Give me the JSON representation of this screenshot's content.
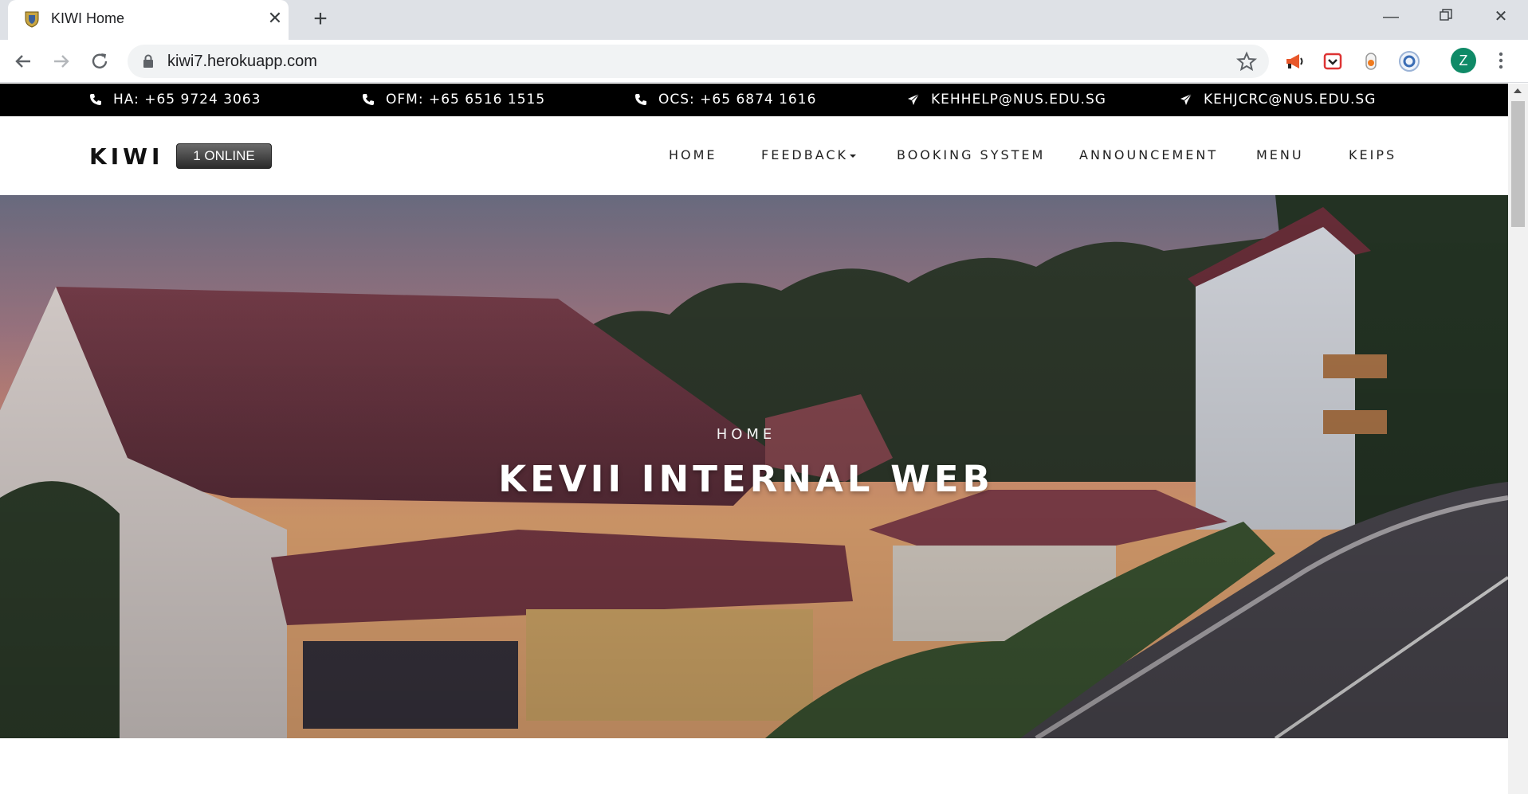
{
  "browser": {
    "tab": {
      "title": "KIWI Home"
    },
    "url": "kiwi7.herokuapp.com",
    "profile_initial": "Z",
    "extensions": [
      "megaphone-extension-icon",
      "pocket-extension-icon",
      "pill-extension-icon",
      "circle-extension-icon"
    ]
  },
  "contacts": [
    {
      "label": "HA: +65 9724 3063",
      "icon": "phone-icon"
    },
    {
      "label": "OFM: +65 6516 1515",
      "icon": "phone-icon"
    },
    {
      "label": "OCS: +65 6874 1616",
      "icon": "phone-icon"
    },
    {
      "label": "KEHHELP@NUS.EDU.SG",
      "icon": "paper-plane-icon"
    },
    {
      "label": "KEHJCRC@NUS.EDU.SG",
      "icon": "paper-plane-icon"
    }
  ],
  "navbar": {
    "brand": "KIWI",
    "online_badge": "1 ONLINE",
    "items": [
      {
        "label": "HOME"
      },
      {
        "label": "FEEDBACK"
      },
      {
        "label": "BOOKING SYSTEM"
      },
      {
        "label": "ANNOUNCEMENT"
      },
      {
        "label": "MENU"
      },
      {
        "label": "KEIPS"
      }
    ]
  },
  "hero": {
    "subtitle": "HOME",
    "title": "KEVII INTERNAL WEB"
  },
  "colors": {
    "contact_bar": "#000000",
    "tabstrip": "#dee1e6",
    "profile": "#0f8a67"
  }
}
